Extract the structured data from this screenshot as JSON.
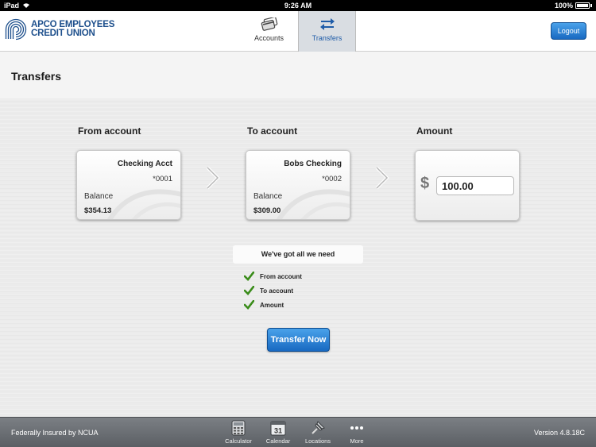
{
  "statusbar": {
    "device": "iPad",
    "time": "9:26 AM",
    "battery": "100%"
  },
  "header": {
    "logo_line1": "APCO EMPLOYEES",
    "logo_line2": "CREDIT UNION",
    "tabs": [
      {
        "label": "Accounts",
        "icon": "cards-icon"
      },
      {
        "label": "Transfers",
        "icon": "transfer-arrows-icon",
        "active": true
      }
    ],
    "logout_label": "Logout"
  },
  "page": {
    "title": "Transfers"
  },
  "transfer": {
    "from_label": "From account",
    "to_label": "To account",
    "amount_label": "Amount",
    "from": {
      "name": "Checking Acct",
      "number": "*0001",
      "balance_label": "Balance",
      "balance": "$354.13"
    },
    "to": {
      "name": "Bobs Checking",
      "number": "*0002",
      "balance_label": "Balance",
      "balance": "$309.00"
    },
    "currency": "$",
    "amount": "100.00"
  },
  "checklist": {
    "heading": "We've got all we need",
    "items": [
      "From account",
      "To account",
      "Amount"
    ]
  },
  "actions": {
    "transfer_label": "Transfer Now"
  },
  "footer": {
    "insured": "Federally Insured by NCUA",
    "version": "Version 4.8.18C",
    "calendar_day": "31",
    "tabs": [
      "Calculator",
      "Calendar",
      "Locations",
      "More"
    ]
  },
  "colors": {
    "brand": "#1d4f8c",
    "button": "#1869c1",
    "check": "#3a8c1a"
  }
}
